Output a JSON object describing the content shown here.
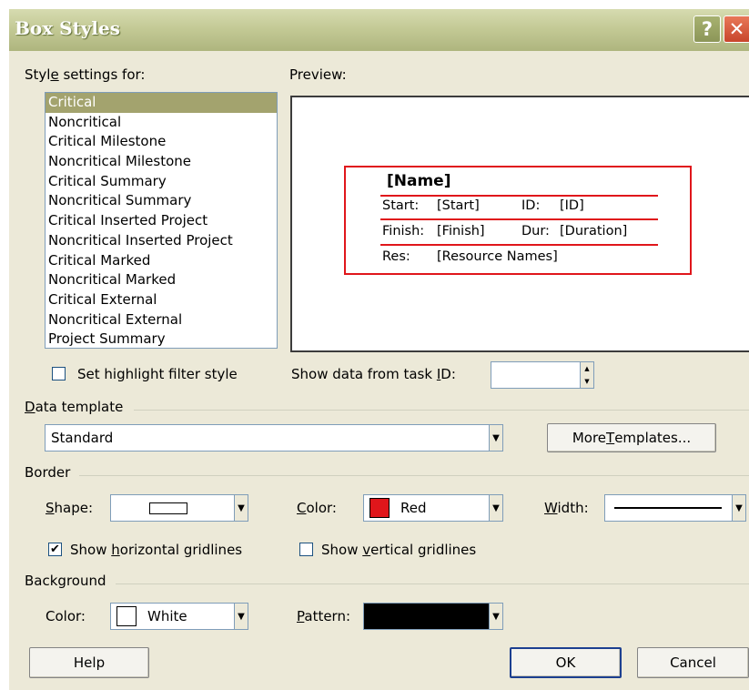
{
  "window": {
    "title": "Box Styles",
    "help_glyph": "?",
    "close_glyph": "✕"
  },
  "style_settings": {
    "label_pre": "Styl",
    "label_u": "e",
    "label_post": " settings for:",
    "items": [
      "Critical",
      "Noncritical",
      "Critical Milestone",
      "Noncritical Milestone",
      "Critical Summary",
      "Noncritical Summary",
      "Critical Inserted Project",
      "Noncritical Inserted Project",
      "Critical Marked",
      "Noncritical Marked",
      "Critical External",
      "Noncritical External",
      "Project Summary"
    ],
    "selected": "Critical"
  },
  "preview": {
    "label": "Preview:",
    "name": "[Name]",
    "start_label": "Start:",
    "start_value": "[Start]",
    "id_label": "ID:",
    "id_value": "[ID]",
    "finish_label": "Finish:",
    "finish_value": "[Finish]",
    "dur_label": "Dur:",
    "dur_value": "[Duration]",
    "res_label": "Res:",
    "res_value": "[Resource Names]",
    "border_color": "#e0161b"
  },
  "highlight": {
    "label": "Set highlight filter style",
    "checked": false,
    "check_glyph": ""
  },
  "task_id": {
    "label_pre": "Show data from task ",
    "label_u": "I",
    "label_post": "D:",
    "value": "",
    "up": "▲",
    "down": "▼"
  },
  "data_template": {
    "group_pre": "",
    "group_u": "D",
    "group_post": "ata template",
    "value": "Standard",
    "arrow": "▼",
    "more_pre": "More ",
    "more_u": "T",
    "more_post": "emplates..."
  },
  "border": {
    "group": "Border",
    "shape_u": "S",
    "shape_post": "hape:",
    "shape_arrow": "▼",
    "color_u": "C",
    "color_post": "olor:",
    "color_value": "Red",
    "color_hex": "#e0161b",
    "color_arrow": "▼",
    "width_u": "W",
    "width_post": "idth:",
    "width_arrow": "▼",
    "hgrid_pre": "Show ",
    "hgrid_u": "h",
    "hgrid_post": "orizontal gridlines",
    "hgrid_check": "✔",
    "vgrid_pre": "Show ",
    "vgrid_u": "v",
    "vgrid_post": "ertical gridlines",
    "vgrid_check": ""
  },
  "background": {
    "group": "Background",
    "color_label": "Color:",
    "color_value": "White",
    "color_hex": "#ffffff",
    "color_arrow": "▼",
    "pattern_u": "P",
    "pattern_post": "attern:",
    "pattern_hex": "#000000",
    "pattern_arrow": "▼"
  },
  "buttons": {
    "help": "Help",
    "ok": "OK",
    "cancel": "Cancel"
  }
}
